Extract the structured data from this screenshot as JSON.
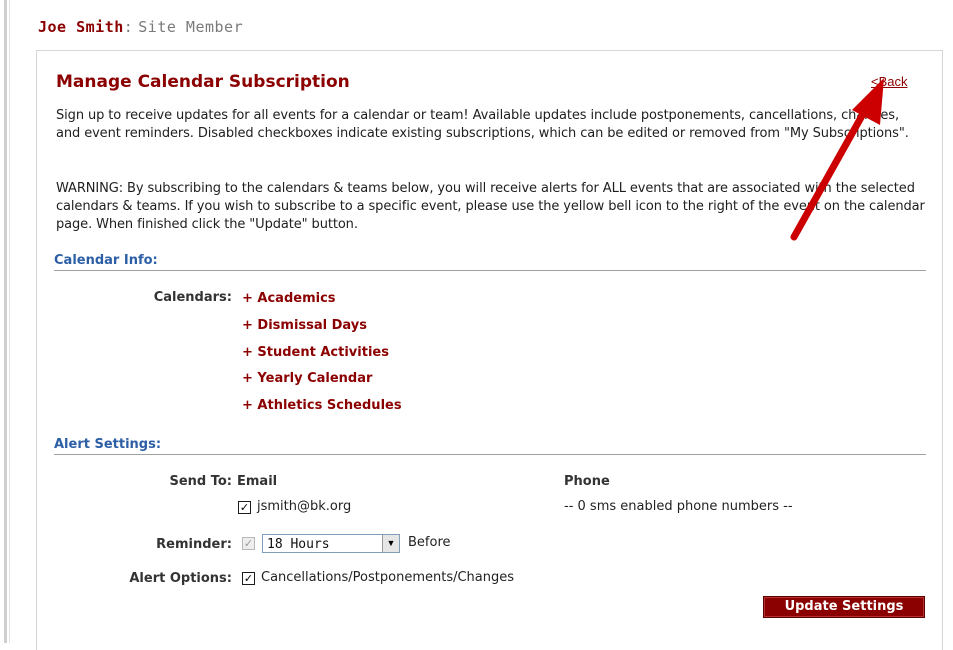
{
  "user": {
    "name": "Joe Smith",
    "separator": ":",
    "role": "Site Member"
  },
  "page": {
    "title": "Manage Calendar Subscription",
    "back_label": "<Back",
    "intro": "Sign up to receive updates for all events for a calendar or team! Available updates include postponements, cancellations, changes, and event reminders. Disabled checkboxes indicate existing subscriptions, which can be edited or removed from \"My Subscriptions\".",
    "warning": "WARNING: By subscribing to the calendars & teams below, you will receive alerts for ALL events that are associated with the selected calendars & teams. If you wish to subscribe to a specific event, please use the yellow bell icon to the right of the event on the calendar page. When finished click the \"Update\" button."
  },
  "calendar_info": {
    "heading": "Calendar Info:",
    "label": "Calendars:",
    "items": [
      "+ Academics",
      "+ Dismissal Days",
      "+ Student Activities",
      "+ Yearly Calendar",
      "+ Athletics Schedules"
    ]
  },
  "alert_settings": {
    "heading": "Alert Settings:",
    "send_to_label": "Send To:",
    "email_header": "Email",
    "phone_header": "Phone",
    "email_value": "jsmith@bk.org",
    "email_checked": true,
    "phone_value": "-- 0 sms enabled phone numbers --",
    "reminder_label": "Reminder:",
    "reminder_checked": true,
    "reminder_value": "18 Hours",
    "reminder_suffix": "Before",
    "alert_options_label": "Alert Options:",
    "alert_option_text": "Cancellations/Postponements/Changes",
    "alert_option_checked": true,
    "update_button": "Update Settings"
  },
  "colors": {
    "brand_red": "#8b0000",
    "section_blue": "#2d5fa6",
    "annotation_arrow": "#cc0000"
  },
  "icons": {
    "checkbox_check": "check-icon",
    "select_arrow": "chevron-down-icon",
    "annotation": "arrow-icon"
  }
}
